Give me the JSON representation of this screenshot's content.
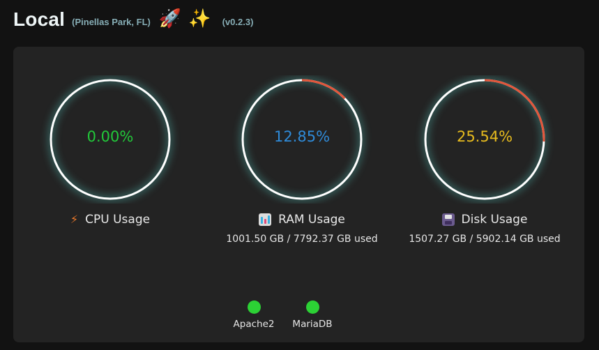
{
  "header": {
    "title": "Local",
    "location": "(Pinellas Park, FL)",
    "emoji_1": "🚀",
    "emoji_2": "✨",
    "version": "(v0.2.3)"
  },
  "gauges": [
    {
      "id": "cpu",
      "value_text": "0.00%",
      "percent": 0.0,
      "label": "CPU Usage",
      "icon": "lightning-bolt-icon",
      "detail": "",
      "value_color": "#22c93a"
    },
    {
      "id": "ram",
      "value_text": "12.85%",
      "percent": 12.85,
      "label": "RAM Usage",
      "icon": "bar-chart-icon",
      "detail": "1001.50 GB / 7792.37 GB used",
      "value_color": "#2f8bd9"
    },
    {
      "id": "disk",
      "value_text": "25.54%",
      "percent": 25.54,
      "label": "Disk Usage",
      "icon": "floppy-disk-icon",
      "detail": "1507.27 GB / 5902.14 GB used",
      "value_color": "#e8bc1e"
    }
  ],
  "services": [
    {
      "name": "Apache2",
      "status_color": "#2cd135"
    },
    {
      "name": "MariaDB",
      "status_color": "#2cd135"
    }
  ],
  "colors": {
    "background": "#121212",
    "card": "#232323",
    "ring": "#ffffff",
    "ring_glow": "#5be0d6",
    "usage_arc": "#e3553a"
  }
}
